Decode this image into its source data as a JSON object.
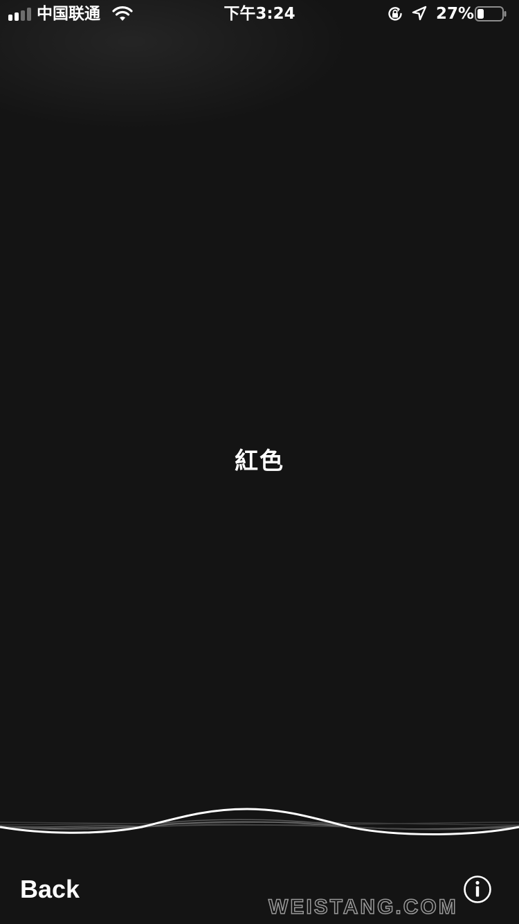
{
  "status_bar": {
    "carrier": "中国联通",
    "time": "下午3:24",
    "battery_percent_label": "27%",
    "battery_level": 0.27,
    "signal_bars_filled": 2,
    "signal_bars_total": 4,
    "icons": [
      "signal-icon",
      "wifi-icon",
      "orientation-lock-icon",
      "location-arrow-icon",
      "battery-icon"
    ]
  },
  "siri": {
    "recognized_text": "紅色"
  },
  "bottom_bar": {
    "back_label": "Back",
    "info_icon": "info-icon"
  },
  "watermark": {
    "text": "WEISTANG.COM"
  },
  "colors": {
    "background": "#141414",
    "foreground": "#ffffff"
  }
}
